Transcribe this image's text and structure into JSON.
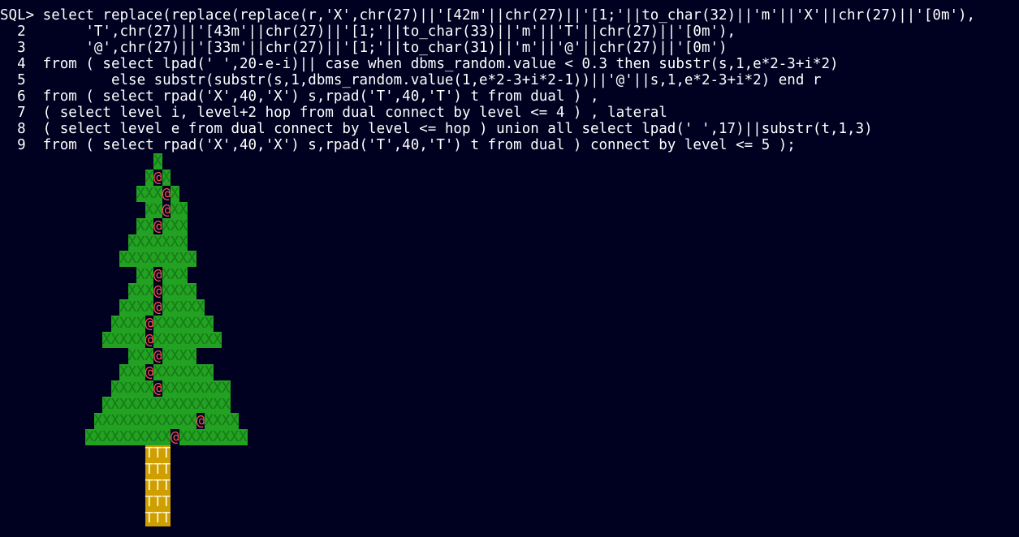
{
  "terminal": {
    "colors": {
      "background": "#000021",
      "text": "#ffffff",
      "needles_bg": "#22a122",
      "needles_fg": "#177a17",
      "ornament_fg": "#ff4d4d",
      "trunk_bg": "#cf9e00",
      "trunk_fg": "#fff6cc"
    },
    "sql_lines": [
      "SQL> select replace(replace(replace(r,'X',chr(27)||'[42m'||chr(27)||'[1;'||to_char(32)||'m'||'X'||chr(27)||'[0m'),",
      "  2       'T',chr(27)||'[43m'||chr(27)||'[1;'||to_char(33)||'m'||'T'||chr(27)||'[0m'),",
      "  3       '@',chr(27)||'[33m'||chr(27)||'[1;'||to_char(31)||'m'||'@'||chr(27)||'[0m')",
      "  4  from ( select lpad(' ',20-e-i)|| case when dbms_random.value < 0.3 then substr(s,1,e*2-3+i*2)",
      "  5          else substr(substr(s,1,dbms_random.value(1,e*2-3+i*2-1))||'@'||s,1,e*2-3+i*2) end r",
      "  6  from ( select rpad('X',40,'X') s,rpad('T',40,'T') t from dual ) ,",
      "  7  ( select level i, level+2 hop from dual connect by level <= 4 ) , lateral",
      "  8  ( select level e from dual connect by level <= hop ) union all select lpad(' ',17)||substr(t,1,3)",
      "  9  from ( select rpad('X',40,'X') s,rpad('T',40,'T') t from dual ) connect by level <= 5 );"
    ],
    "output_rows": [
      "                  X",
      "                 X@X",
      "                XXX@X",
      "                 XX@XX",
      "                XX@XXX",
      "               XXXXXXX",
      "              XXXXXXXXX",
      "                XX@XXX",
      "               XXX@XXXX",
      "              XXXX@XXXXX",
      "             XXXX@XXXXXXX",
      "            XXXXX@XXXXXXXX",
      "               XXX@XXXX",
      "              XXX@XXXXXXX",
      "             XXXXX@XXXXXXXX",
      "            XXXXXXXXXXXXXXX",
      "           XXXXXXXXXXXX@XXXX",
      "          XXXXXXXXXX@XXXXXXXX",
      "                 TTT",
      "                 TTT",
      "                 TTT",
      "                 TTT",
      "                 TTT"
    ]
  }
}
